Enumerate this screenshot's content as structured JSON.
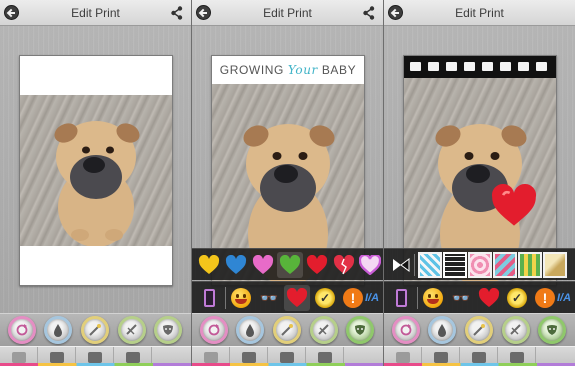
{
  "panels": [
    {
      "title": "Edit Print",
      "print_style": "plain",
      "active_tool": ""
    },
    {
      "title": "Edit Print",
      "print_style": "banner",
      "active_tool": "stickers",
      "banner_text": {
        "left": "GROWING",
        "script": "Your",
        "right": "BABY"
      }
    },
    {
      "title": "Edit Print",
      "print_style": "filmstrip",
      "active_tool": "frames"
    }
  ],
  "sticker_tray_hearts": {
    "colors": [
      "#f3c51b",
      "#2f86d4",
      "#e86bc8",
      "#58b43a",
      "#e31d2d",
      "#e33046",
      "#c95cd6"
    ],
    "names": [
      "yellow-heart-icon",
      "blue-heart-icon",
      "pink-heart-icon",
      "green-heart-icon",
      "red-heart-icon",
      "broken-heart-icon",
      "purple-heart-icon"
    ]
  },
  "sticker_tray_categories": {
    "ia_label": "I/A",
    "badge_label": "✓",
    "exclaim_label": "!",
    "glasses_glyph": "👓"
  },
  "frame_tray": {
    "names": [
      "bow-frame-icon",
      "sky-pattern-frame",
      "film-frame",
      "floral-frame",
      "pattern-frame",
      "stripe-frame",
      "gold-frame"
    ]
  },
  "toolbar": {
    "buttons": [
      "rotate-button",
      "water-drop-button",
      "magic-wand-button",
      "crop-button",
      "stickers-button"
    ]
  },
  "bottombar": {
    "buttons": [
      "copy-button",
      "save-button",
      "print-button",
      "gallery-button",
      "overflow-button"
    ]
  },
  "colors": {
    "accent_pink": "#e48ec3",
    "accent_green": "#8fc86b",
    "heart_red": "#e31d2d",
    "banner_teal": "#3fb3c7"
  }
}
